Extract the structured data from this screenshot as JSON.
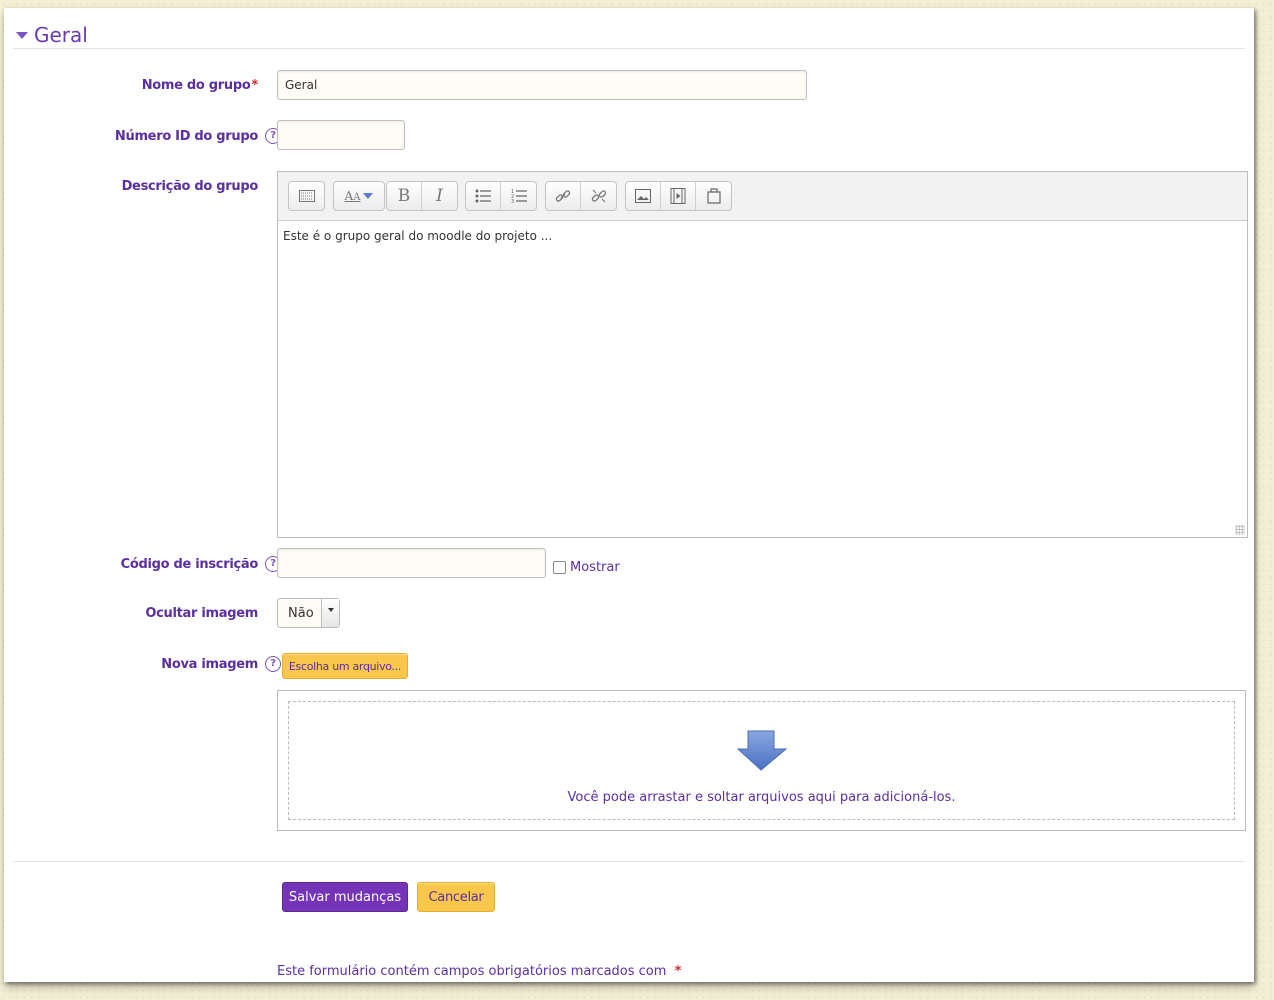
{
  "section": {
    "title": "Geral"
  },
  "fields": {
    "group_name": {
      "label": "Nome do grupo",
      "required_mark": "*",
      "value": "Geral"
    },
    "group_id": {
      "label": "Número ID do grupo",
      "help": "?",
      "value": ""
    },
    "description": {
      "label": "Descrição do grupo",
      "content": "Este é o grupo geral do moodle do projeto ..."
    },
    "enrolment_key": {
      "label": "Código de inscrição",
      "help": "?",
      "value": "",
      "show_label": "Mostrar"
    },
    "hide_picture": {
      "label": "Ocultar imagem",
      "selected": "Não"
    },
    "new_picture": {
      "label": "Nova imagem",
      "help": "?",
      "choose_button": "Escolha um arquivo...",
      "drop_text": "Você pode arrastar e soltar arquivos aqui para adicioná-los."
    }
  },
  "editor_toolbar": [
    [
      "toolbar-toggle-icon"
    ],
    [
      "font-style-icon"
    ],
    [
      "bold-icon",
      "italic-icon"
    ],
    [
      "unordered-list-icon",
      "ordered-list-icon"
    ],
    [
      "link-icon",
      "unlink-icon"
    ],
    [
      "image-icon",
      "media-icon",
      "file-manager-icon"
    ]
  ],
  "actions": {
    "save": "Salvar mudanças",
    "cancel": "Cancelar"
  },
  "footer": {
    "note": "Este formulário contém campos obrigatórios marcados com",
    "required_mark": "*"
  },
  "colors": {
    "accent": "#7534b8",
    "label": "#5b2f9f",
    "required": "#d0272c",
    "button_yellow": "#fac74d"
  }
}
